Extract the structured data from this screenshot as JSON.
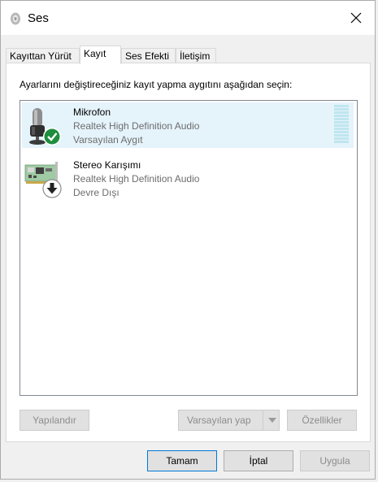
{
  "window": {
    "title": "Ses"
  },
  "tabs": [
    {
      "label": "Kayıttan Yürüt",
      "active": false
    },
    {
      "label": "Kayıt",
      "active": true
    },
    {
      "label": "Ses Efekti",
      "active": false
    },
    {
      "label": "İletişim",
      "active": false
    }
  ],
  "panel": {
    "instruction": "Ayarlarını değiştireceğiniz kayıt yapma aygıtını aşağıdan seçin:"
  },
  "devices": [
    {
      "name": "Mikrofon",
      "driver": "Realtek High Definition Audio",
      "status": "Varsayılan Aygıt",
      "selected": true,
      "icon": "microphone-icon",
      "badge": "default-check-icon"
    },
    {
      "name": "Stereo Karışımı",
      "driver": "Realtek High Definition Audio",
      "status": "Devre Dışı",
      "selected": false,
      "icon": "sound-card-icon",
      "badge": "disabled-arrow-icon"
    }
  ],
  "buttons": {
    "configure": "Yapılandır",
    "set_default": "Varsayılan yap",
    "properties": "Özellikler",
    "ok": "Tamam",
    "cancel": "İptal",
    "apply": "Uygula"
  },
  "colors": {
    "selection": "#e5f3fb",
    "check_badge": "#1e8e3e",
    "meter": "#bfe6ef",
    "focus_border": "#0078d7"
  }
}
